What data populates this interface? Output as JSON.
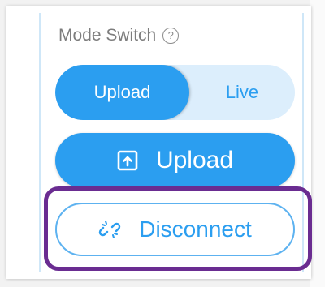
{
  "mode_switch": {
    "label": "Mode Switch",
    "help_icon": "question-circle-icon",
    "help_glyph": "?",
    "options": [
      {
        "label": "Upload",
        "active": true
      },
      {
        "label": "Live",
        "active": false
      }
    ]
  },
  "actions": {
    "upload_label": "Upload",
    "upload_icon": "upload-box-icon",
    "disconnect_label": "Disconnect",
    "disconnect_icon": "broken-link-icon"
  },
  "colors": {
    "accent": "#2b9ef0",
    "toggle_track": "#dceefc",
    "label_gray": "#7d7d7d",
    "highlight": "#6a2c91"
  }
}
